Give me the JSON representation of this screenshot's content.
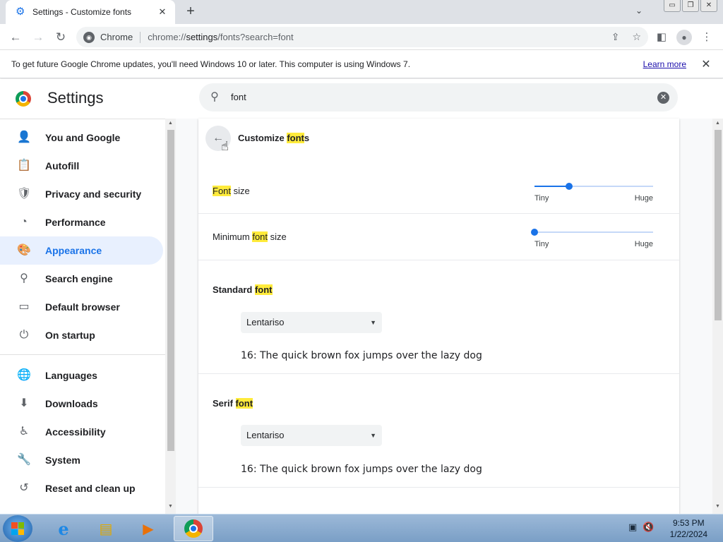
{
  "browser": {
    "tab_title": "Settings - Customize fonts",
    "tab_close": "✕",
    "new_tab": "+",
    "window_controls": [
      "▭",
      "❐",
      "✕"
    ],
    "chip_label": "Chrome",
    "url_prefix": "chrome://",
    "url_highlight": "settings",
    "url_suffix": "/fonts?search=font",
    "icons": [
      "back-arrow-icon",
      "forward-arrow-icon",
      "reload-icon",
      "share-icon",
      "star-icon",
      "sidepanel-icon",
      "profile-icon",
      "menu-icon"
    ]
  },
  "infobar": {
    "message": "To get future Google Chrome updates, you'll need Windows 10 or later. This computer is using Windows 7.",
    "link": "Learn more",
    "close": "✕"
  },
  "header": {
    "title": "Settings",
    "search_value": "font"
  },
  "sidebar": {
    "items": [
      {
        "label": "You and Google",
        "icon": "person-icon",
        "glyph": "👤"
      },
      {
        "label": "Autofill",
        "icon": "clipboard-icon",
        "glyph": "📋"
      },
      {
        "label": "Privacy and security",
        "icon": "shield-icon",
        "glyph": "🛡"
      },
      {
        "label": "Performance",
        "icon": "speedometer-icon",
        "glyph": "◔"
      },
      {
        "label": "Appearance",
        "icon": "palette-icon",
        "glyph": "🎨",
        "active": true
      },
      {
        "label": "Search engine",
        "icon": "search-icon",
        "glyph": "⚲"
      },
      {
        "label": "Default browser",
        "icon": "browser-icon",
        "glyph": "▭"
      },
      {
        "label": "On startup",
        "icon": "power-icon",
        "glyph": "⏻"
      },
      {
        "label": "Languages",
        "icon": "globe-icon",
        "glyph": "🌐"
      },
      {
        "label": "Downloads",
        "icon": "download-icon",
        "glyph": "⬇"
      },
      {
        "label": "Accessibility",
        "icon": "accessibility-icon",
        "glyph": "♿"
      },
      {
        "label": "System",
        "icon": "wrench-icon",
        "glyph": "🔧"
      },
      {
        "label": "Reset and clean up",
        "icon": "history-icon",
        "glyph": "↺"
      }
    ]
  },
  "page": {
    "title_before": "Customize ",
    "title_highlight": "font",
    "title_after": "s",
    "font_size": {
      "label_highlight": "Font",
      "label_after": " size",
      "min_label": "Tiny",
      "max_label": "Huge",
      "value_fraction": 0.29
    },
    "minimum_font_size": {
      "label_before": "Minimum ",
      "label_highlight": "font",
      "label_after": " size",
      "min_label": "Tiny",
      "max_label": "Huge",
      "value_fraction": 0.0
    },
    "standard_font": {
      "label_before": "Standard ",
      "label_highlight": "font",
      "selected": "Lentariso",
      "preview": "16: The quick brown fox jumps over the lazy dog"
    },
    "serif_font": {
      "label_before": "Serif ",
      "label_highlight": "font",
      "selected": "Lentariso",
      "preview": "16: The quick brown fox jumps over the lazy dog"
    }
  },
  "taskbar": {
    "apps": [
      "internet-explorer-icon",
      "file-explorer-icon",
      "media-player-icon",
      "chrome-icon"
    ],
    "time": "9:53 PM",
    "date": "1/22/2024"
  },
  "colors": {
    "accent": "#1a73e8",
    "highlight": "#ffeb3b",
    "active_nav_bg": "#e8f0fe"
  }
}
